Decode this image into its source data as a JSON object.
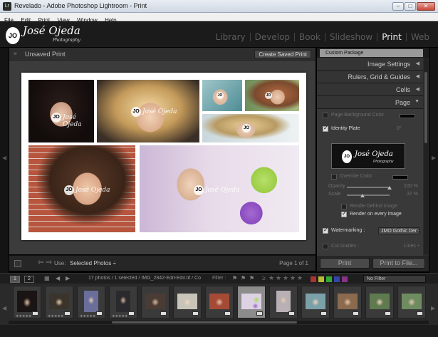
{
  "window": {
    "app_icon": "Lr",
    "title": "Revelado - Adobe Photoshop Lightroom - Print",
    "minimize": "–",
    "maximize": "□",
    "close": "✕"
  },
  "menu": [
    "File",
    "Edit",
    "Print",
    "View",
    "Window",
    "Help"
  ],
  "identity": {
    "badge": "JO",
    "name": "José Ojeda",
    "sub": "Photography"
  },
  "modules": [
    {
      "label": "Library",
      "active": false
    },
    {
      "label": "Develop",
      "active": false
    },
    {
      "label": "Book",
      "active": false
    },
    {
      "label": "Slideshow",
      "active": false
    },
    {
      "label": "Print",
      "active": true
    },
    {
      "label": "Web",
      "active": false
    }
  ],
  "center": {
    "doc_title": "Unsaved Print",
    "create_saved_print": "Create Saved Print",
    "plate_text": "José Ojeda",
    "plate_badge": "JO"
  },
  "center_toolbar": {
    "use_label": "Use:",
    "use_value": "Selected Photos ÷",
    "page_of": "Page 1 of 1"
  },
  "right_panel": {
    "custom_package": "Custom Package",
    "sections": [
      {
        "label": "Image Settings",
        "icon": "triangle-left"
      },
      {
        "label": "Rulers, Grid & Guides",
        "icon": "triangle-left"
      },
      {
        "label": "Cells",
        "icon": "triangle-left"
      },
      {
        "label": "Page",
        "icon": "triangle-down"
      }
    ],
    "page_background_color": "Page Background Color",
    "identity_plate": "Identity Plate",
    "identity_plate_angle": "0°",
    "plate_preview_name": "José Ojeda",
    "plate_preview_sub": "Photography",
    "plate_preview_badge": "JO",
    "override_color": "Override Color",
    "opacity_label": "Opacity",
    "opacity_value": "100 %",
    "opacity_level": 1.0,
    "scale_label": "Scale",
    "scale_value": "37 %",
    "scale_level": 0.37,
    "render_behind": "Render behind image",
    "render_every": "Render on every image",
    "watermarking": "Watermarking :",
    "watermark_value": "JMO Gothic Der ÷",
    "cut_guides": "Cut Guides :",
    "cut_guides_value": "Lines ÷",
    "print_button": "Print",
    "print_to_file_button": "Print to File..."
  },
  "filmstrip_bar": {
    "screen1": "1",
    "screen2": "2",
    "path": "17 photos / 1 selected / IMG_2842-Edit-Edit.tif / Co",
    "filter_label": "Filter :",
    "no_filter": "No Filter"
  },
  "colors": {
    "panel_bg": "#2b2b2b",
    "module_active": "#ececec",
    "module_inactive": "#5c5c5c",
    "selected_cell": "#8c8c8c"
  }
}
